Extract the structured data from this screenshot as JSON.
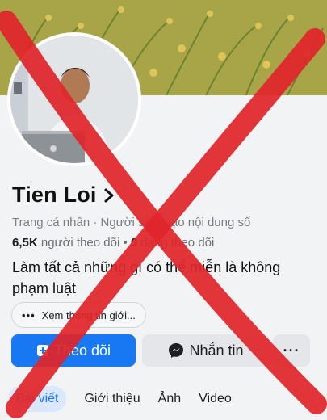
{
  "profile": {
    "name": "Tien Loi",
    "subtitle": "Trang cá nhân · Người sáng tạo nội dung số",
    "followers_count": "6,5K",
    "followers_label": "người theo dõi",
    "following_count": "0",
    "following_label": "đang theo dõi",
    "bio": "Làm tất cả những gì có thể miễn là không phạm luật",
    "more_info_label": "Xem thông tin giới..."
  },
  "actions": {
    "follow_label": "Theo dõi",
    "message_label": "Nhắn tin",
    "more_label": "···"
  },
  "tabs": [
    {
      "label": "Bài viết",
      "active": true
    },
    {
      "label": "Giới thiệu",
      "active": false
    },
    {
      "label": "Ảnh",
      "active": false
    },
    {
      "label": "Video",
      "active": false
    }
  ],
  "colors": {
    "accent": "#1877f2",
    "overlay_x": "#e0262b"
  },
  "icons": {
    "chevron": "chevron-right-icon",
    "follow": "follow-add-icon",
    "message": "messenger-icon",
    "more": "more-dots-icon"
  }
}
